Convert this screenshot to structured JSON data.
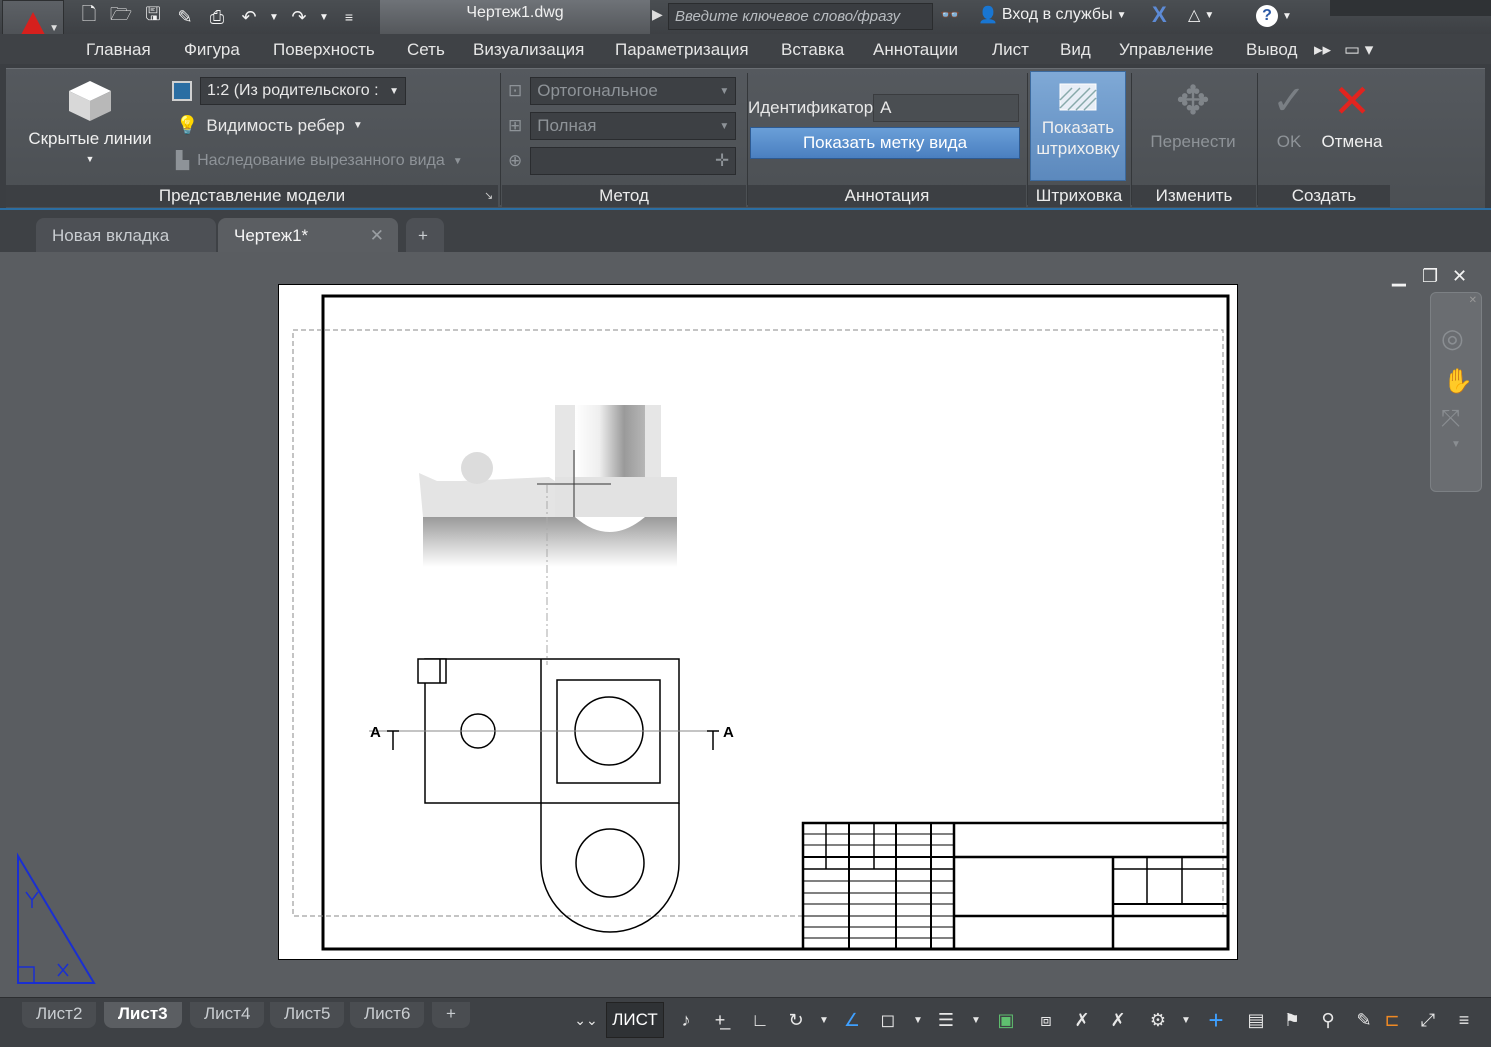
{
  "titlebar": {
    "document_title": "Чертеж1.dwg",
    "search_placeholder": "Введите ключевое слово/фразу",
    "signin_label": "Вход в службы",
    "help_label": "?"
  },
  "ribbon_tabs": [
    "Главная",
    "Фигура",
    "Поверхность",
    "Сеть",
    "Визуализация",
    "Параметризация",
    "Вставка",
    "Аннотации",
    "Лист",
    "Вид",
    "Управление",
    "Вывод"
  ],
  "ribbon": {
    "model_representation": {
      "title": "Представление модели",
      "hidden_lines_label": "Скрытые линии",
      "scale_value": "1:2 (Из родительского :",
      "edge_visibility_label": "Видимость ребер",
      "cut_inheritance_label": "Наследование вырезанного вида"
    },
    "method": {
      "title": "Метод",
      "projection_value": "Ортогональное",
      "section_type_value": "Полная",
      "third_value": ""
    },
    "annotation": {
      "title": "Аннотация",
      "identifier_label": "Идентификатор",
      "identifier_value": "A",
      "show_view_label_button": "Показать метку вида"
    },
    "hatch": {
      "title": "Штриховка",
      "show_hatch_line1": "Показать",
      "show_hatch_line2": "штриховку"
    },
    "modify": {
      "title": "Изменить",
      "move_label": "Перенести"
    },
    "create": {
      "title": "Создать",
      "ok_label": "OK",
      "cancel_label": "Отмена"
    }
  },
  "doc_tabs": [
    {
      "label": "Новая вкладка",
      "active": false
    },
    {
      "label": "Чертеж1*",
      "active": true
    }
  ],
  "drawing": {
    "section_label_left": "A",
    "section_label_right": "A"
  },
  "layout_tabs": [
    {
      "label": "Лист2",
      "active": false
    },
    {
      "label": "Лист3",
      "active": true
    },
    {
      "label": "Лист4",
      "active": false
    },
    {
      "label": "Лист5",
      "active": false
    },
    {
      "label": "Лист6",
      "active": false
    }
  ],
  "status": {
    "space_button": "ЛИСТ"
  },
  "colors": {
    "accent_blue": "#2b6ea3",
    "logo_red": "#d6201d",
    "cancel_red": "#e0241f",
    "ucs_blue": "#1a2fd1"
  }
}
